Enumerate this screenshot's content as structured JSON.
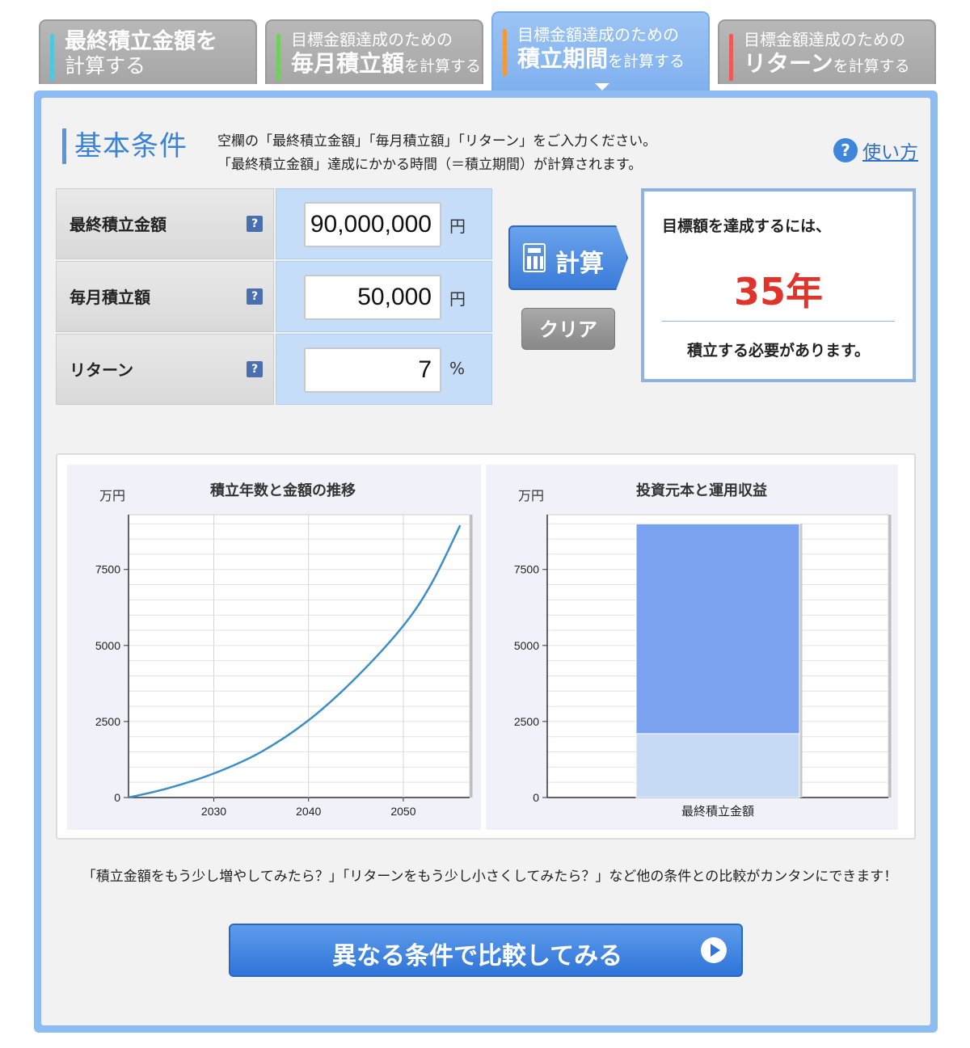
{
  "tabs": [
    {
      "line1": "最終積立金額を",
      "line2": "計算する",
      "color": "#4fc7e0"
    },
    {
      "line1": "目標金額達成のための",
      "line2": "毎月積立額",
      "suffix": "を計算する",
      "color": "#6fd05c"
    },
    {
      "line1": "目標金額達成のための",
      "line2": "積立期間",
      "suffix": "を計算する",
      "color": "#f29a3a"
    },
    {
      "line1": "目標金額達成のための",
      "line2": "リターン",
      "suffix": "を計算する",
      "color": "#ee5a5a"
    }
  ],
  "section": {
    "title": "基本条件",
    "intro1": "空欄の「最終積立金額」「毎月積立額」「リターン」をご入力ください。",
    "intro2": "「最終積立金額」達成にかかる時間（＝積立期間）が計算されます。",
    "howto": "使い方",
    "help_glyph": "?"
  },
  "form": {
    "final_label": "最終積立金額",
    "final_value": "90,000,000",
    "final_unit": "円",
    "monthly_label": "毎月積立額",
    "monthly_value": "50,000",
    "monthly_unit": "円",
    "return_label": "リターン",
    "return_value": "7",
    "return_unit": "%"
  },
  "buttons": {
    "calc": "計算",
    "clear": "クリア"
  },
  "result": {
    "line1": "目標額を達成するには、",
    "years": "35年",
    "line2": "積立する必要があります。"
  },
  "chart_data": [
    {
      "type": "line",
      "title": "積立年数と金額の推移",
      "ylabel": "万円",
      "x_ticks": [
        2030,
        2040,
        2050
      ],
      "y_ticks": [
        0,
        2500,
        5000,
        7500
      ],
      "xlim": [
        2021,
        2057
      ],
      "ylim": [
        0,
        9300
      ],
      "x": [
        2021,
        2025,
        2030,
        2035,
        2040,
        2045,
        2050,
        2053,
        2056
      ],
      "series": [
        {
          "values": [
            0,
            290,
            790,
            1500,
            2540,
            3940,
            5650,
            7050,
            8950
          ],
          "color": "#3b8ec8"
        }
      ]
    },
    {
      "type": "bar",
      "title": "投資元本と運用収益",
      "ylabel": "万円",
      "categories": [
        "最終積立金額"
      ],
      "y_ticks": [
        0,
        2500,
        5000,
        7500
      ],
      "ylim": [
        0,
        9300
      ],
      "series": [
        {
          "values": [
            2100
          ],
          "color": "#c6daf6"
        },
        {
          "values": [
            6900
          ],
          "color": "#7aa2ee"
        }
      ]
    }
  ],
  "compare": {
    "text": "「積立金額をもう少し増やしてみたら？」「リターンをもう少し小さくしてみたら？」など他の条件との比較がカンタンにできます！",
    "button": "異なる条件で比較してみる"
  }
}
